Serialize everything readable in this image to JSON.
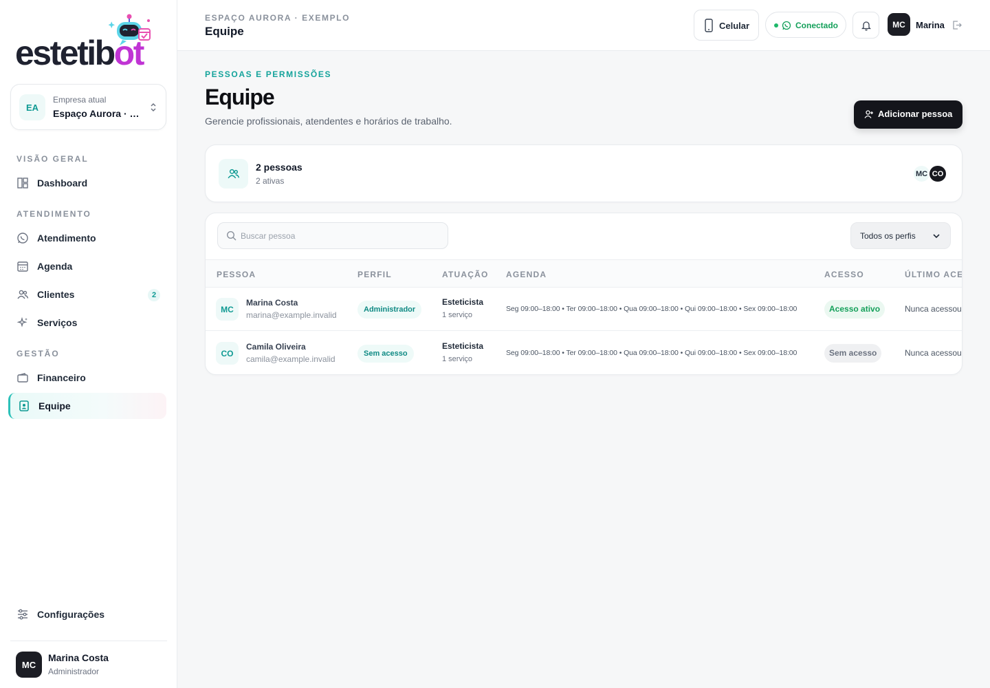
{
  "brand": {
    "logo_text_a": "estetib",
    "logo_text_b": "ot"
  },
  "company": {
    "initials": "EA",
    "label": "Empresa atual",
    "name": "Espaço Aurora · Exemplo"
  },
  "sidebar": {
    "sections": [
      {
        "title": "VISÃO GERAL"
      },
      {
        "title": "ATENDIMENTO"
      },
      {
        "title": "GESTÃO"
      }
    ],
    "items": [
      {
        "label": "Dashboard",
        "icon": "dashboard-icon"
      },
      {
        "label": "Atendimento",
        "icon": "whatsapp-icon"
      },
      {
        "label": "Agenda",
        "icon": "calendar-icon"
      },
      {
        "label": "Clientes",
        "icon": "users-icon",
        "count": "2"
      },
      {
        "label": "Serviços",
        "icon": "sparkles-icon"
      },
      {
        "label": "Financeiro",
        "icon": "wallet-icon"
      },
      {
        "label": "Equipe",
        "icon": "badge-icon",
        "active": true
      },
      {
        "label": "Configurações",
        "icon": "sliders-icon"
      }
    ],
    "user": {
      "initials": "MC",
      "name": "Marina Costa",
      "role": "Administrador"
    }
  },
  "topbar": {
    "breadcrumb": "ESPAÇO AURORA · EXEMPLO",
    "title": "Equipe",
    "phone_label": "Celular",
    "status_label": "Conectado",
    "user_initials": "MC",
    "user_name": "Marina"
  },
  "page": {
    "eyebrow": "PESSOAS E PERMISSÕES",
    "title": "Equipe",
    "subtitle": "Gerencie profissionais, atendentes e horários de trabalho.",
    "add_button": "Adicionar pessoa"
  },
  "summary": {
    "count_label": "2 pessoas",
    "active_label": "2 ativas",
    "avatars": [
      "MC",
      "CO"
    ]
  },
  "table": {
    "search_placeholder": "Buscar pessoa",
    "filter_label": "Todos os perfis",
    "headers": [
      "PESSOA",
      "PERFIL",
      "ATUAÇÃO",
      "AGENDA",
      "ACESSO",
      "ÚLTIMO ACESSO"
    ],
    "rows": [
      {
        "initials": "MC",
        "name": "Marina Costa",
        "email": "marina@example.invalid",
        "profile": "Administrador",
        "role": "Esteticista",
        "services": "1 serviço",
        "schedule": "Seg 09:00–18:00 • Ter 09:00–18:00 • Qua 09:00–18:00 • Qui 09:00–18:00 • Sex 09:00–18:00",
        "access": "Acesso ativo",
        "last_access": "Nunca acessou"
      },
      {
        "initials": "CO",
        "name": "Camila Oliveira",
        "email": "camila@example.invalid",
        "profile": "Sem acesso",
        "role": "Esteticista",
        "services": "1 serviço",
        "schedule": "Seg 09:00–18:00 • Ter 09:00–18:00 • Qua 09:00–18:00 • Qui 09:00–18:00 • Sex 09:00–18:00",
        "access": "Sem acesso",
        "last_access": "Nunca acessou"
      }
    ]
  },
  "colors": {
    "accent": "#14a39b",
    "dark": "#14151b",
    "success": "#14a05a"
  }
}
